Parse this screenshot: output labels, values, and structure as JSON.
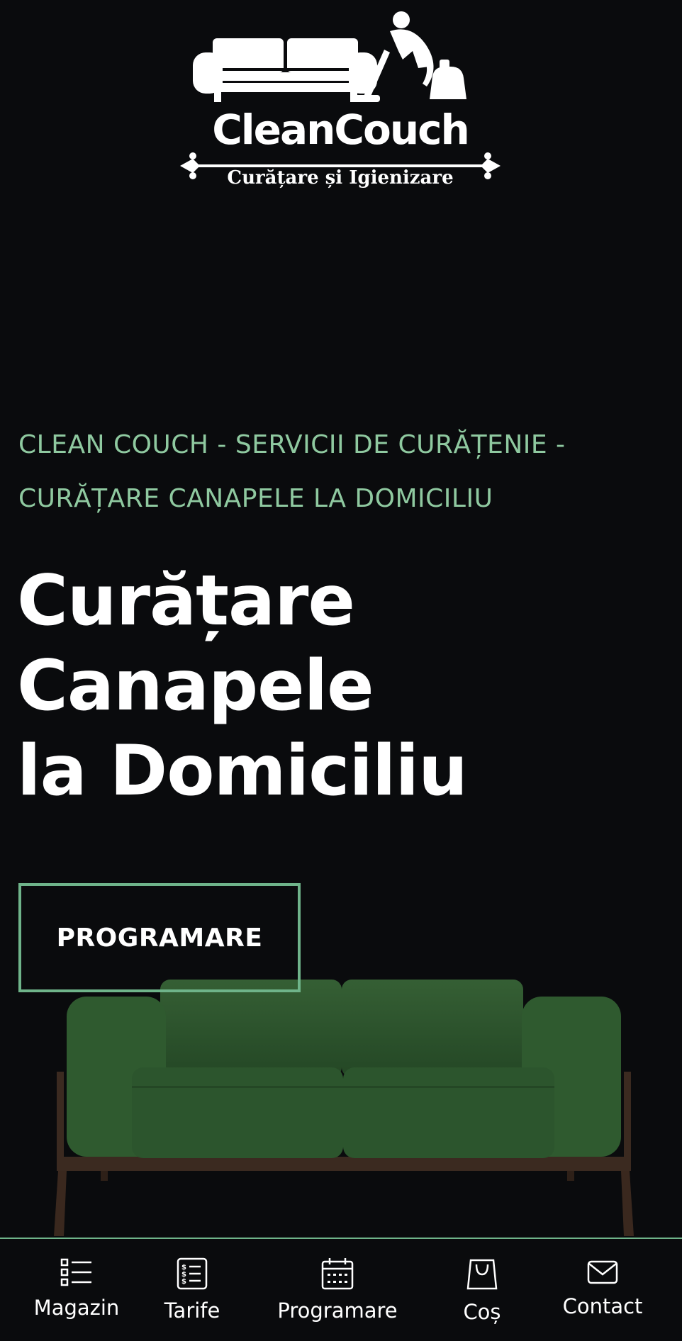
{
  "logo": {
    "name": "CleanCouch",
    "tagline": "Curățare și Igienizare"
  },
  "hero": {
    "eyebrow": "CLEAN COUCH - SERVICII DE CURĂȚENIE - CURĂȚARE CANAPELE LA DOMICILIU",
    "headline_line1": "Curățare",
    "headline_line2": "Canapele",
    "headline_line3": "la Domiciliu",
    "cta_label": "PROGRAMARE"
  },
  "bottom_nav": [
    {
      "label": "Magazin",
      "icon": "list-icon"
    },
    {
      "label": "Tarife",
      "icon": "price-list-icon"
    },
    {
      "label": "Programare",
      "icon": "calendar-icon"
    },
    {
      "label": "Coș",
      "icon": "shopping-bag-icon"
    },
    {
      "label": "Contact",
      "icon": "envelope-icon"
    }
  ],
  "colors": {
    "background": "#0a0b0d",
    "accent": "#6fb48a",
    "eyebrow": "#8fc9a0",
    "sofa": "#2f5a30"
  }
}
